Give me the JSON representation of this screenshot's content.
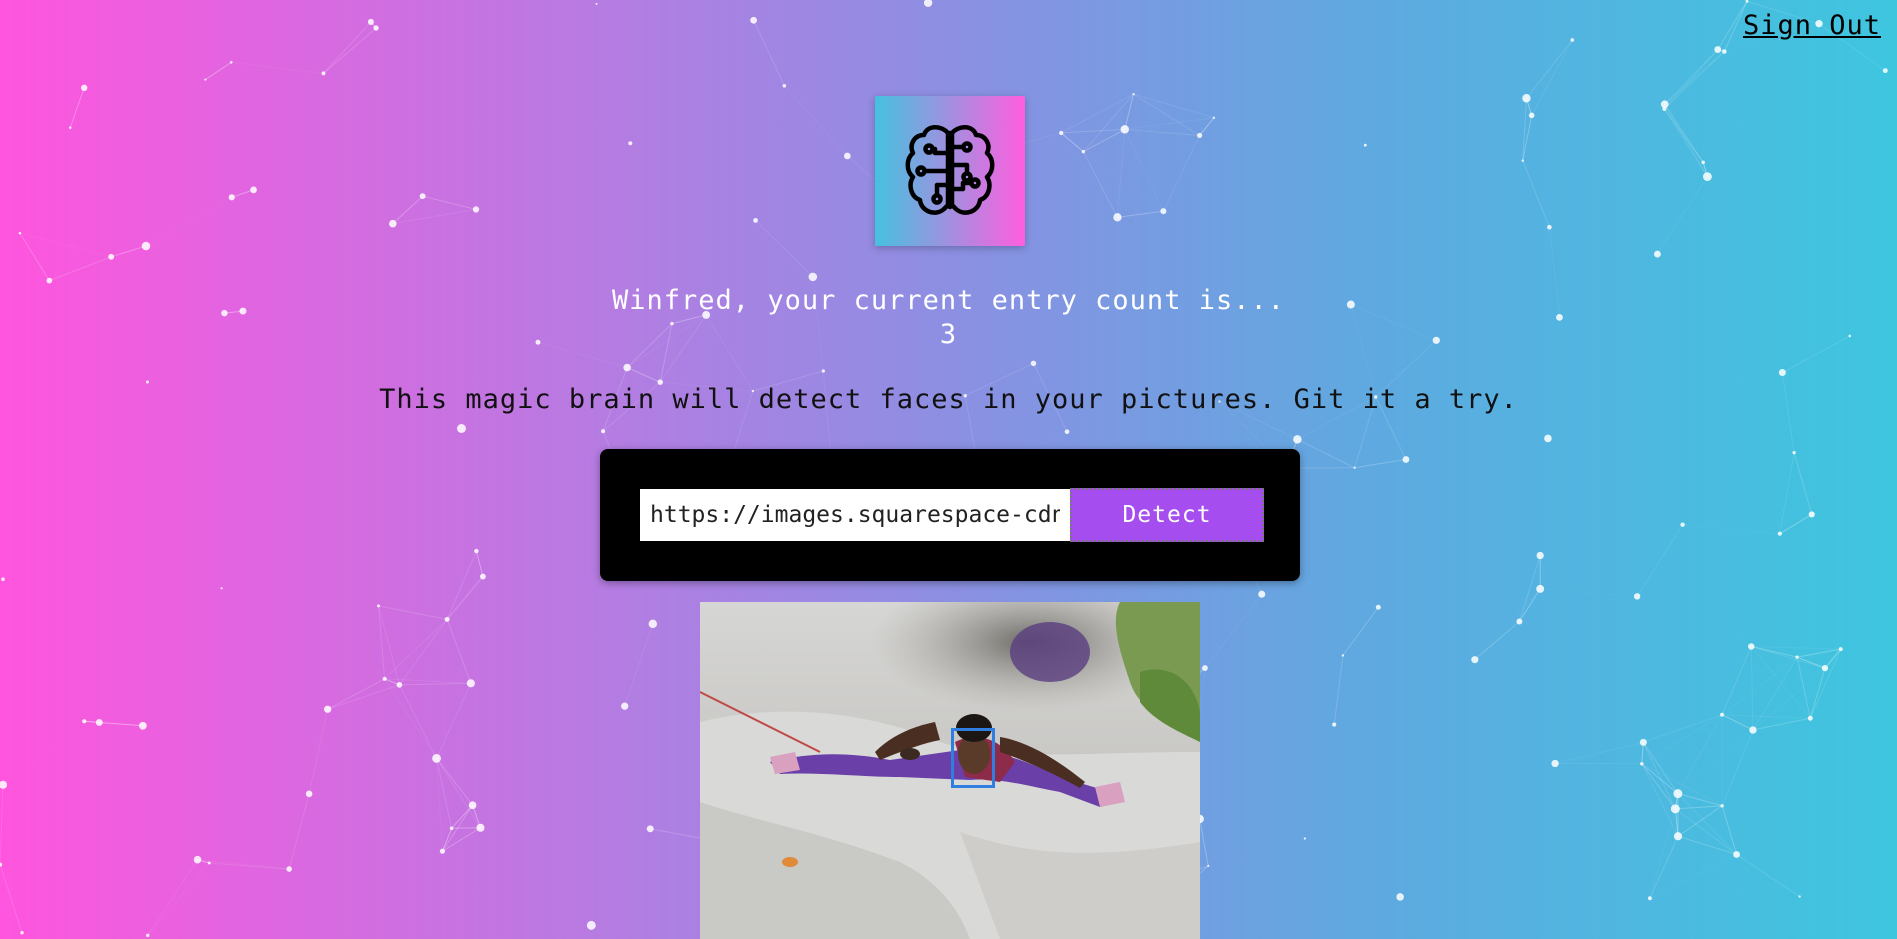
{
  "header": {
    "sign_out_label": "Sign Out"
  },
  "logo": {
    "icon": "brain-circuit-icon"
  },
  "rank": {
    "message": "Winfred, your current entry count is...",
    "count": "3"
  },
  "tagline": "This magic brain will detect faces in your pictures. Git it a try.",
  "form": {
    "url_value": "https://images.squarespace-cdn.com",
    "detect_label": "Detect"
  },
  "image": {
    "face_boxes_detected": 1
  },
  "colors": {
    "gradient_left": "#ff55de",
    "gradient_right": "#3ec6df",
    "button": "#a64df0",
    "face_box": "#2f7fe0"
  }
}
